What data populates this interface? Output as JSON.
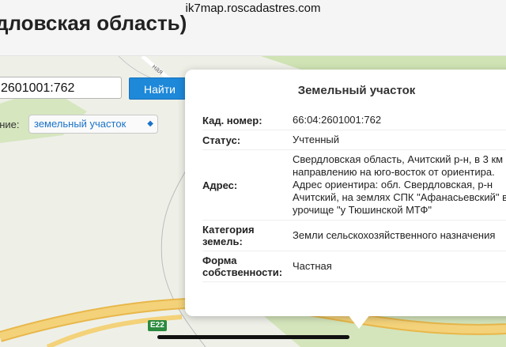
{
  "browser": {
    "url": "ik7map.roscadastres.com"
  },
  "header": {
    "title": "дловская область)"
  },
  "search": {
    "value": "2601001:762",
    "find_label": "Найти"
  },
  "mode": {
    "label": "ение:",
    "selected": "земельный участок"
  },
  "popup": {
    "title": "Земельный участок",
    "rows": [
      {
        "label": "Кад. номер:",
        "value": "66:04:2601001:762"
      },
      {
        "label": "Статус:",
        "value": "Учтенный"
      },
      {
        "label": "Адрес:",
        "value": "Свердловская область, Ачитский р-н, в 3 км по направлению на юго-восток от ориентира. Адрес ориентира: обл. Свердловская, р-н Ачитский, на землях СПК \"Афанасьевский\" в урочище \"у Тюшинской МТФ\""
      },
      {
        "label": "Категория земель:",
        "value": "Земли сельскохозяйственного назначения"
      },
      {
        "label": "Форма собственности:",
        "value": "Частная"
      }
    ]
  },
  "map": {
    "road_label": "E22",
    "street_label": "ная"
  },
  "colors": {
    "accent": "#1e88d9",
    "road": "#f3d27a",
    "green": "#cfe3b4"
  }
}
